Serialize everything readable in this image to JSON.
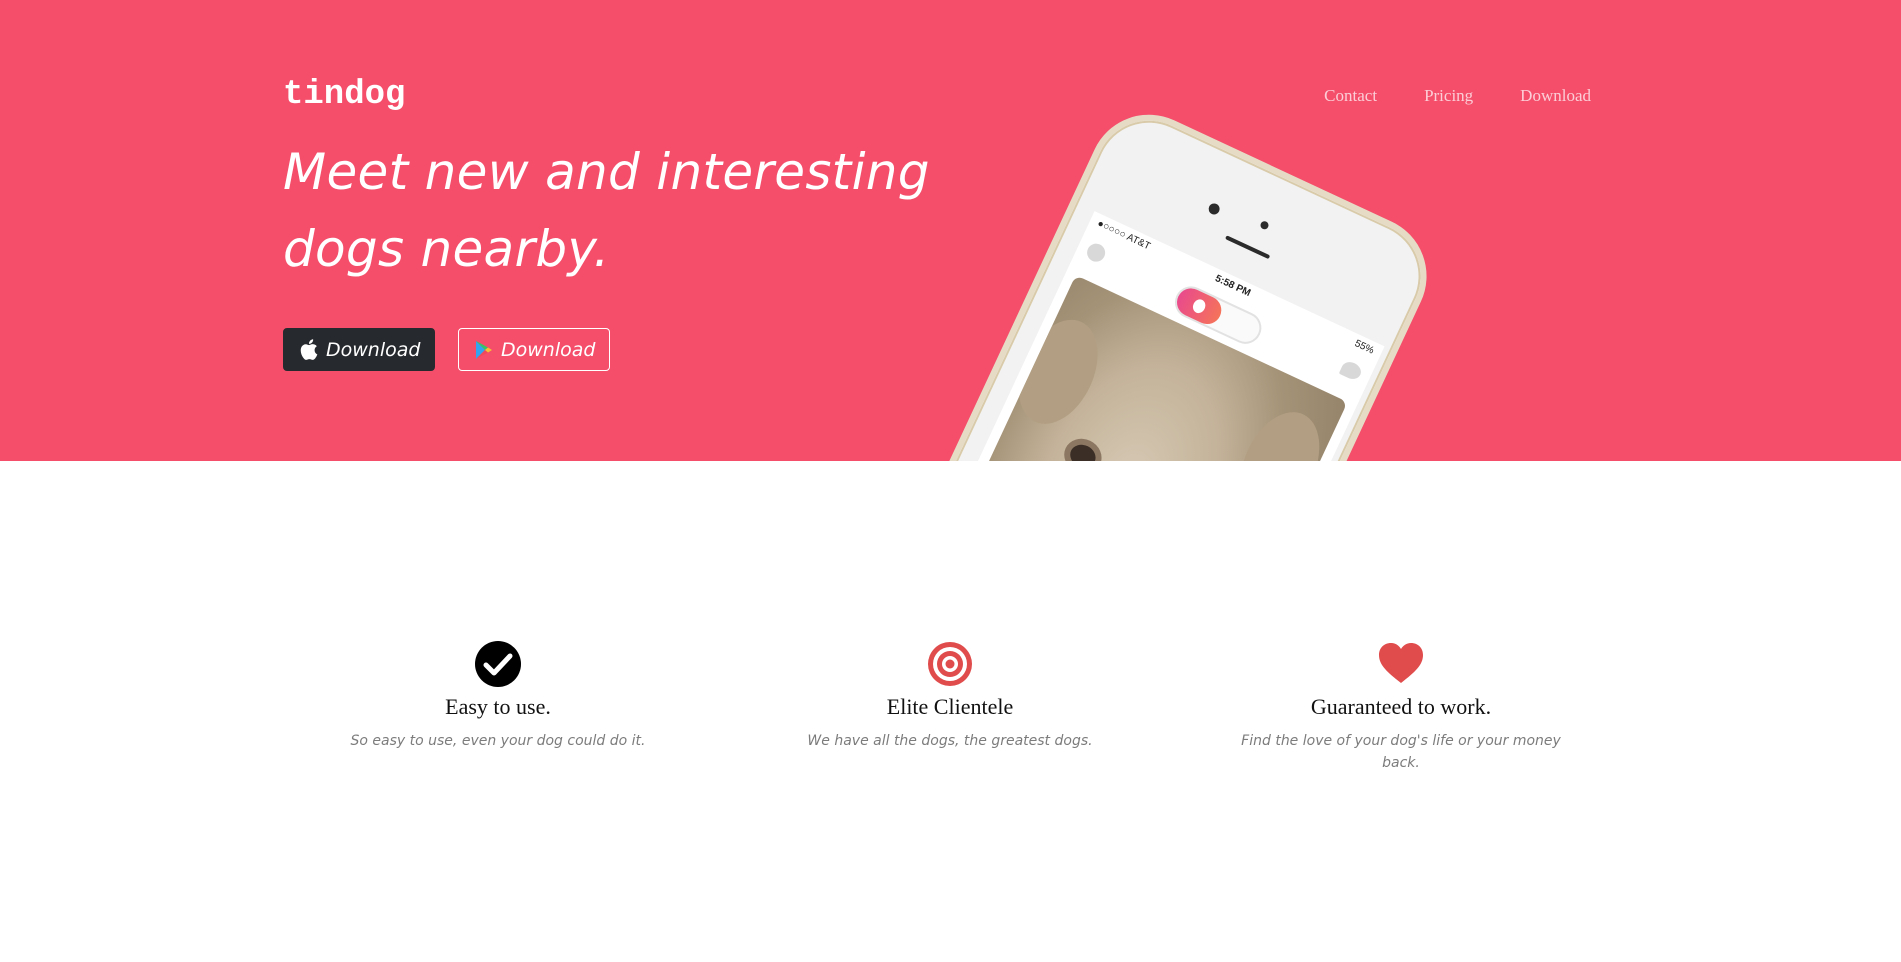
{
  "colors": {
    "hero_bg": "#f44e6b",
    "dark_button": "#26292e",
    "icon_red": "#e04b4b",
    "white": "#ffffff"
  },
  "nav": {
    "brand": "tindog",
    "links": [
      "Contact",
      "Pricing",
      "Download"
    ]
  },
  "hero": {
    "headline": "Meet new and interesting dogs nearby.",
    "buttons": [
      {
        "label": "Download",
        "icon": "apple-icon"
      },
      {
        "label": "Download",
        "icon": "google-play-icon"
      }
    ]
  },
  "phone": {
    "carrier": "●○○○○ AT&T",
    "time": "5:58 PM",
    "battery": "55%"
  },
  "features": [
    {
      "icon": "check-circle-icon",
      "title": "Easy to use.",
      "text": "So easy to use, even your dog could do it."
    },
    {
      "icon": "bullseye-icon",
      "title": "Elite Clientele",
      "text": "We have all the dogs, the greatest dogs."
    },
    {
      "icon": "heart-icon",
      "title": "Guaranteed to work.",
      "text": "Find the love of your dog's life or your money back."
    }
  ]
}
